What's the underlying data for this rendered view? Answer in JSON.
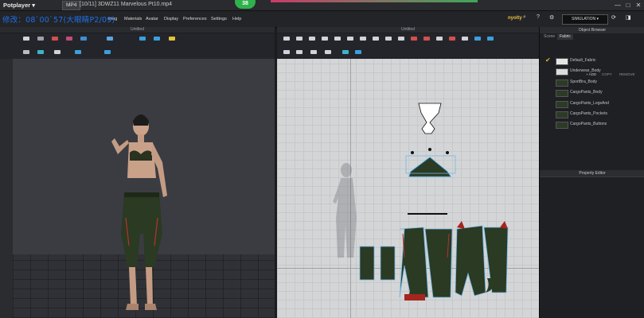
{
  "titlebar": {
    "brand": "Potplayer ▾",
    "file_tag": "MP4",
    "filename": "[10/11] 3DWZ11 Marvelous Pt10.mp4",
    "badge": "38",
    "controls": [
      "—",
      "□",
      "✕"
    ]
  },
  "overlay": {
    "chinese_text": "修改：08`00`57(大眼睛P2/09)"
  },
  "menu": {
    "items": [
      "wing",
      "Materials",
      "Avatar",
      "Display",
      "Preferences",
      "Settings",
      "Help"
    ],
    "logo": "nyolty",
    "simulation_label": "SIMULATION ▾",
    "right_icons": [
      "search-icon",
      "help-icon",
      "settings-icon"
    ]
  },
  "panes": {
    "left_title": "Untitled",
    "center_title": "Untitled"
  },
  "object_browser": {
    "title": "Object Browser",
    "tabs": [
      "Scene",
      "Fabric"
    ],
    "actions": [
      "+ ADD",
      "COPY",
      "REMOVE"
    ],
    "fabrics": [
      {
        "label": "Default_Fabric",
        "selected": true,
        "color": "#e6e6e6"
      },
      {
        "label": "Underwear_Body",
        "selected": false,
        "color": "#dcdcdc"
      },
      {
        "label": "SportBra_Body",
        "selected": false,
        "color": "#2c3a26"
      },
      {
        "label": "CargoPants_Body",
        "selected": false,
        "color": "#2c3a26"
      },
      {
        "label": "CargoPants_LegsAnd",
        "selected": false,
        "color": "#2c3a26"
      },
      {
        "label": "CargoPants_Pockets",
        "selected": false,
        "color": "#2c3a26"
      },
      {
        "label": "CargoPants_Buttons",
        "selected": false,
        "color": "#2c3a26"
      }
    ]
  },
  "property_editor": {
    "title": "Property Editor"
  },
  "colors": {
    "accent": "#2fb24b",
    "check": "#e2b52e",
    "garment": "#2b3a23",
    "trim": "#b5322e"
  }
}
